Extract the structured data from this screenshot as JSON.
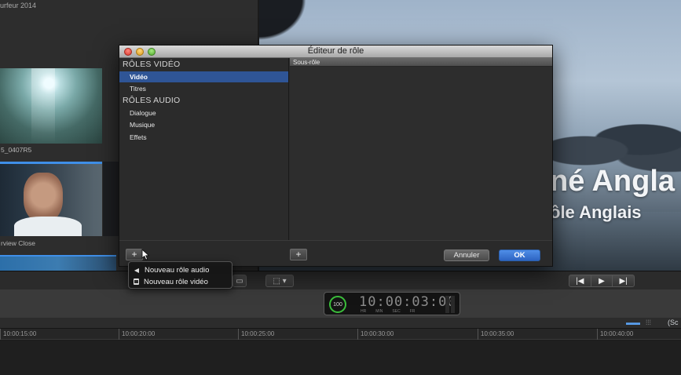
{
  "browser": {
    "event_title": "urfeur 2014",
    "clips": [
      {
        "label": "5_0407R5"
      },
      {
        "label": "rview Close"
      }
    ]
  },
  "viewer": {
    "title_line1": "né Angla",
    "title_line2": "ôle Anglais"
  },
  "dashboard": {
    "badge": "100",
    "timecode": "10:00:03:00",
    "units": [
      "HR",
      "MIN",
      "SEC",
      "FR"
    ]
  },
  "transport": {
    "prev": "|◀",
    "play": "▶",
    "next": "▶|"
  },
  "timeline": {
    "ruler": [
      "10:00:15:00",
      "10:00:20:00",
      "10:00:25:00",
      "10:00:30:00",
      "10:00:35:00",
      "10:00:40:00"
    ],
    "audio_label": "(Sc"
  },
  "dialog": {
    "title": "Éditeur de rôle",
    "video_group": "RÔLES VIDÉO",
    "video_roles": [
      "Vidéo",
      "Titres"
    ],
    "audio_group": "RÔLES AUDIO",
    "audio_roles": [
      "Dialogue",
      "Musique",
      "Effets"
    ],
    "selected_role": "Vidéo",
    "subrole_header": "Sous-rôle",
    "add_role_button": "+",
    "add_subrole_button": "+",
    "cancel_label": "Annuler",
    "ok_label": "OK"
  },
  "popup_menu": {
    "items": [
      {
        "label": "Nouveau rôle audio",
        "icon": "speaker-icon"
      },
      {
        "label": "Nouveau rôle vidéo",
        "icon": "film-icon"
      }
    ]
  },
  "colors": {
    "selection": "#2f5596",
    "ok_button": "#3d7ad6",
    "timecode_ring": "#3bbf3b"
  }
}
